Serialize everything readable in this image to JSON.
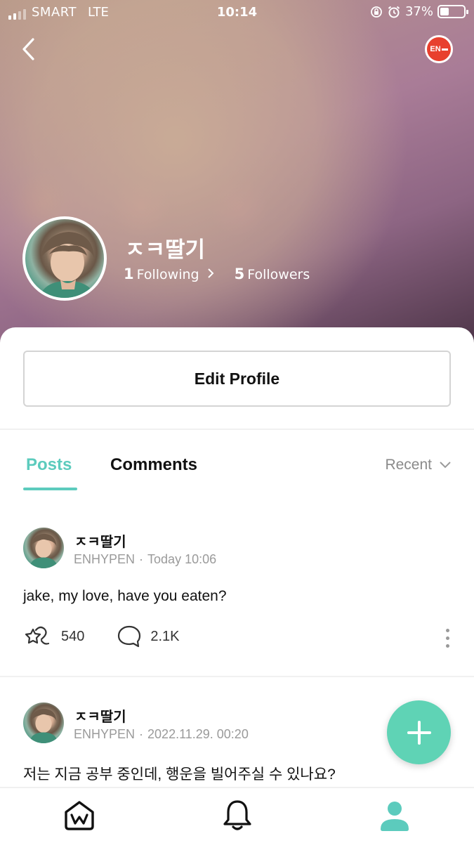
{
  "status_bar": {
    "carrier": "SMART",
    "network": "LTE",
    "time": "10:14",
    "battery": "37%",
    "battery_level": 0.37
  },
  "header": {
    "badge_text": "EN",
    "user_name": "ㅈㅋ딸기",
    "following_count": "1",
    "following_label": "Following",
    "followers_count": "5",
    "followers_label": "Followers"
  },
  "edit_profile_label": "Edit Profile",
  "tabs": {
    "posts_label": "Posts",
    "comments_label": "Comments",
    "sort_label": "Recent"
  },
  "posts": [
    {
      "author": "ㅈㅋ딸기",
      "community": "ENHYPEN",
      "time": "Today 10:06",
      "text": "jake, my love, have you eaten?",
      "likes": "540",
      "comments": "2.1K"
    },
    {
      "author": "ㅈㅋ딸기",
      "community": "ENHYPEN",
      "time": "2022.11.29. 00:20",
      "text": "저는 지금 공부 중인데, 행운을 빌어주실 수 있나요?"
    }
  ],
  "colors": {
    "accent": "#5ccbbd",
    "fab": "#5fd3b5",
    "badge": "#e8402e"
  },
  "icons": {
    "home": "weverse-home-icon",
    "notifications": "bell-icon",
    "profile": "person-icon"
  }
}
